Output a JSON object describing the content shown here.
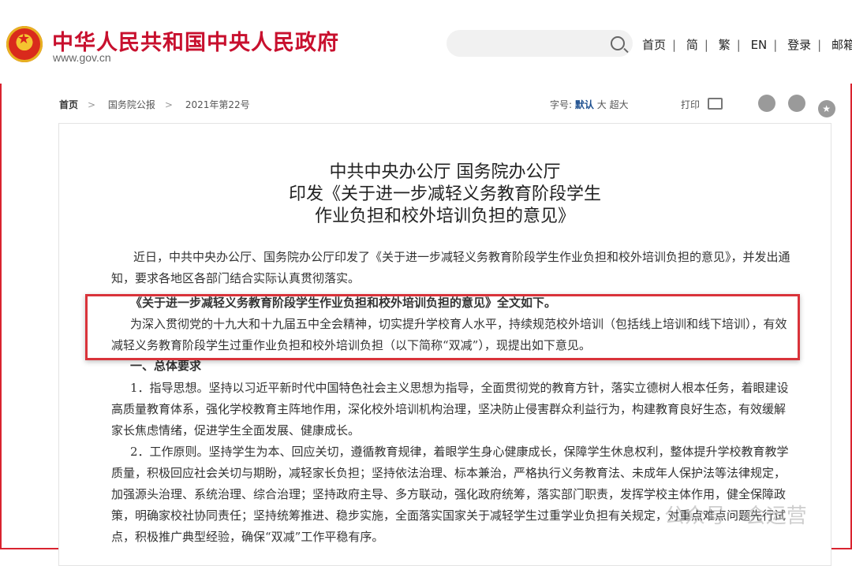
{
  "header": {
    "site_title": "中华人民共和国中央人民政府",
    "site_url": "www.gov.cn",
    "search_placeholder": "",
    "nav": [
      "首页",
      "简",
      "繁",
      "EN",
      "登录",
      "邮箱"
    ]
  },
  "breadcrumb": {
    "home": "首页",
    "section": "国务院公报",
    "issue": "2021年第22号"
  },
  "font_size": {
    "label": "字号:",
    "default": "默认",
    "large": "大",
    "xlarge": "超大"
  },
  "print_label": "打印",
  "document": {
    "title_line1": "中共中央办公厅 国务院办公厅",
    "title_line2": "印发《关于进一步减轻义务教育阶段学生",
    "title_line3": "作业负担和校外培训负担的意见》",
    "para1": "近日，中共中央办公厅、国务院办公厅印发了《关于进一步减轻义务教育阶段学生作业负担和校外培训负担的意见》，并发出通知，要求各地区各部门结合实际认真贯彻落实。",
    "para2": "《关于进一步减轻义务教育阶段学生作业负担和校外培训负担的意见》全文如下。",
    "para3": "为深入贯彻党的十九大和十九届五中全会精神，切实提升学校育人水平，持续规范校外培训（包括线上培训和线下培训），有效减轻义务教育阶段学生过重作业负担和校外培训负担（以下简称“双减”），现提出如下意见。",
    "section1": "一、总体要求",
    "para4": "1．指导思想。坚持以习近平新时代中国特色社会主义思想为指导，全面贯彻党的教育方针，落实立德树人根本任务，着眼建设高质量教育体系，强化学校教育主阵地作用，深化校外培训机构治理，坚决防止侵害群众利益行为，构建教育良好生态，有效缓解家长焦虑情绪，促进学生全面发展、健康成长。",
    "para5": "2．工作原则。坚持学生为本、回应关切，遵循教育规律，着眼学生身心健康成长，保障学生休息权利，整体提升学校教育教学质量，积极回应社会关切与期盼，减轻家长负担；坚持依法治理、标本兼治，严格执行义务教育法、未成年人保护法等法律规定，加强源头治理、系统治理、综合治理；坚持政府主导、多方联动，强化政府统筹，落实部门职责，发挥学校主体作用，健全保障政策，明确家校社协同责任；坚持统筹推进、稳步实施，全面落实国家关于减轻学生过重学业负担有关规定，对重点难点问题先行试点，积极推广典型经验，确保“双减”工作平稳有序。"
  },
  "watermark": "公众号 · 会运营"
}
